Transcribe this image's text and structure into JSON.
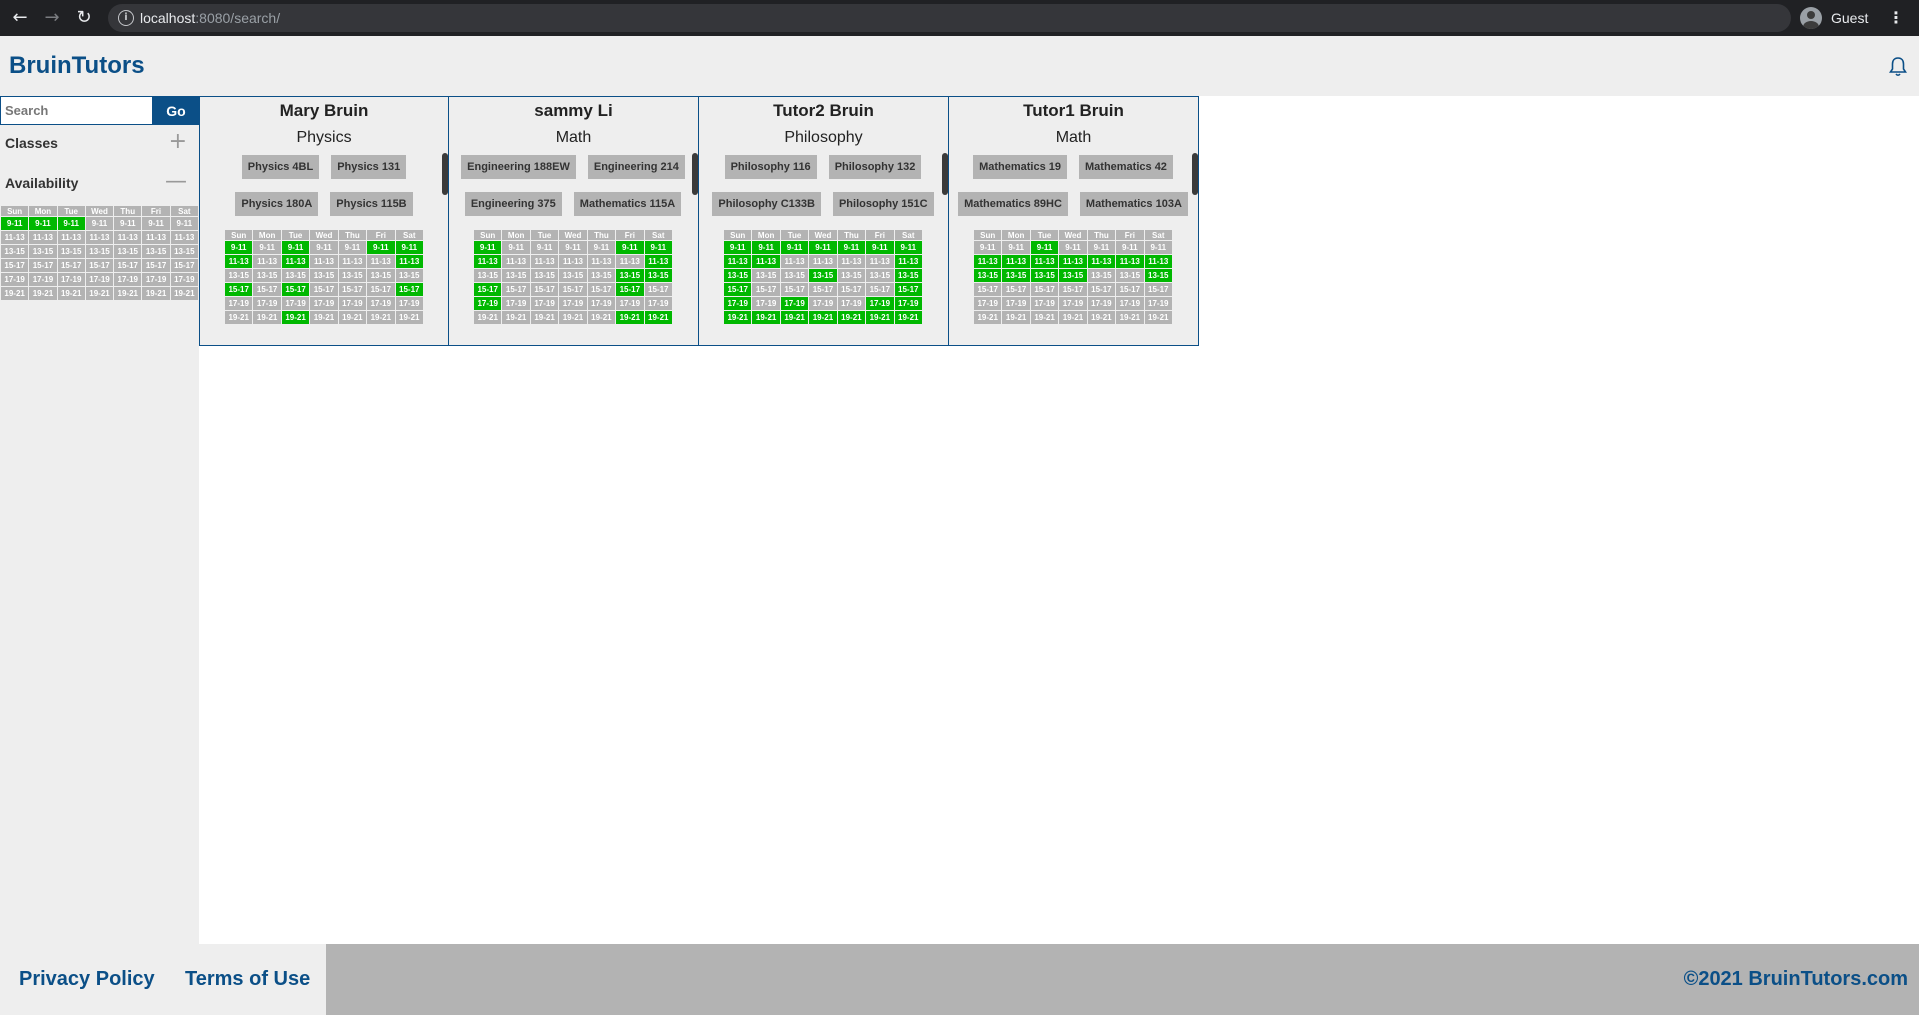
{
  "browser": {
    "url_host": "localhost",
    "url_rest": ":8080/search/",
    "profile_name": "Guest"
  },
  "header": {
    "brand": "BruinTutors"
  },
  "sidebar": {
    "search_placeholder": "Search",
    "go_label": "Go",
    "classes_label": "Classes",
    "availability_label": "Availability",
    "days": [
      "Sun",
      "Mon",
      "Tue",
      "Wed",
      "Thu",
      "Fri",
      "Sat"
    ],
    "slots": [
      "9-11",
      "11-13",
      "13-15",
      "15-17",
      "17-19",
      "19-21"
    ],
    "selected": [
      [
        1,
        1,
        1,
        0,
        0,
        0,
        0
      ],
      [
        0,
        0,
        0,
        0,
        0,
        0,
        0
      ],
      [
        0,
        0,
        0,
        0,
        0,
        0,
        0
      ],
      [
        0,
        0,
        0,
        0,
        0,
        0,
        0
      ],
      [
        0,
        0,
        0,
        0,
        0,
        0,
        0
      ],
      [
        0,
        0,
        0,
        0,
        0,
        0,
        0
      ]
    ]
  },
  "tutors": [
    {
      "name": "Mary Bruin",
      "subject": "Physics",
      "classes": [
        "Physics 4BL",
        "Physics 131",
        "Physics 180A",
        "Physics 115B"
      ],
      "availability": [
        [
          1,
          0,
          1,
          0,
          0,
          1,
          1
        ],
        [
          1,
          0,
          1,
          0,
          0,
          0,
          1
        ],
        [
          0,
          0,
          0,
          0,
          0,
          0,
          0
        ],
        [
          1,
          0,
          1,
          0,
          0,
          0,
          1
        ],
        [
          0,
          0,
          0,
          0,
          0,
          0,
          0
        ],
        [
          0,
          0,
          1,
          0,
          0,
          0,
          0
        ]
      ]
    },
    {
      "name": "sammy Li",
      "subject": "Math",
      "classes": [
        "Engineering 188EW",
        "Engineering 214",
        "Engineering 375",
        "Mathematics 115A"
      ],
      "availability": [
        [
          1,
          0,
          0,
          0,
          0,
          1,
          1
        ],
        [
          1,
          0,
          0,
          0,
          0,
          0,
          1
        ],
        [
          0,
          0,
          0,
          0,
          0,
          1,
          1
        ],
        [
          1,
          0,
          0,
          0,
          0,
          1,
          0
        ],
        [
          1,
          0,
          0,
          0,
          0,
          0,
          0
        ],
        [
          0,
          0,
          0,
          0,
          0,
          1,
          1
        ]
      ]
    },
    {
      "name": "Tutor2 Bruin",
      "subject": "Philosophy",
      "classes": [
        "Philosophy 116",
        "Philosophy 132",
        "Philosophy C133B",
        "Philosophy 151C"
      ],
      "availability": [
        [
          1,
          1,
          1,
          1,
          1,
          1,
          1
        ],
        [
          1,
          1,
          0,
          0,
          0,
          0,
          1
        ],
        [
          1,
          0,
          0,
          1,
          0,
          0,
          1
        ],
        [
          1,
          0,
          0,
          0,
          0,
          0,
          1
        ],
        [
          1,
          0,
          1,
          0,
          0,
          1,
          1
        ],
        [
          1,
          1,
          1,
          1,
          1,
          1,
          1
        ]
      ]
    },
    {
      "name": "Tutor1 Bruin",
      "subject": "Math",
      "classes": [
        "Mathematics 19",
        "Mathematics 42",
        "Mathematics 89HC",
        "Mathematics 103A"
      ],
      "availability": [
        [
          0,
          0,
          1,
          0,
          0,
          0,
          0
        ],
        [
          1,
          1,
          1,
          1,
          1,
          1,
          1
        ],
        [
          1,
          1,
          1,
          1,
          0,
          0,
          1
        ],
        [
          0,
          0,
          0,
          0,
          0,
          0,
          0
        ],
        [
          0,
          0,
          0,
          0,
          0,
          0,
          0
        ],
        [
          0,
          0,
          0,
          0,
          0,
          0,
          0
        ]
      ]
    }
  ],
  "footer": {
    "privacy": "Privacy Policy",
    "terms": "Terms of Use",
    "copyright": "©2021 BruinTutors.com"
  },
  "colors": {
    "brand": "#0b4f87",
    "available": "#00b800",
    "unavailable": "#b3b3b3"
  }
}
